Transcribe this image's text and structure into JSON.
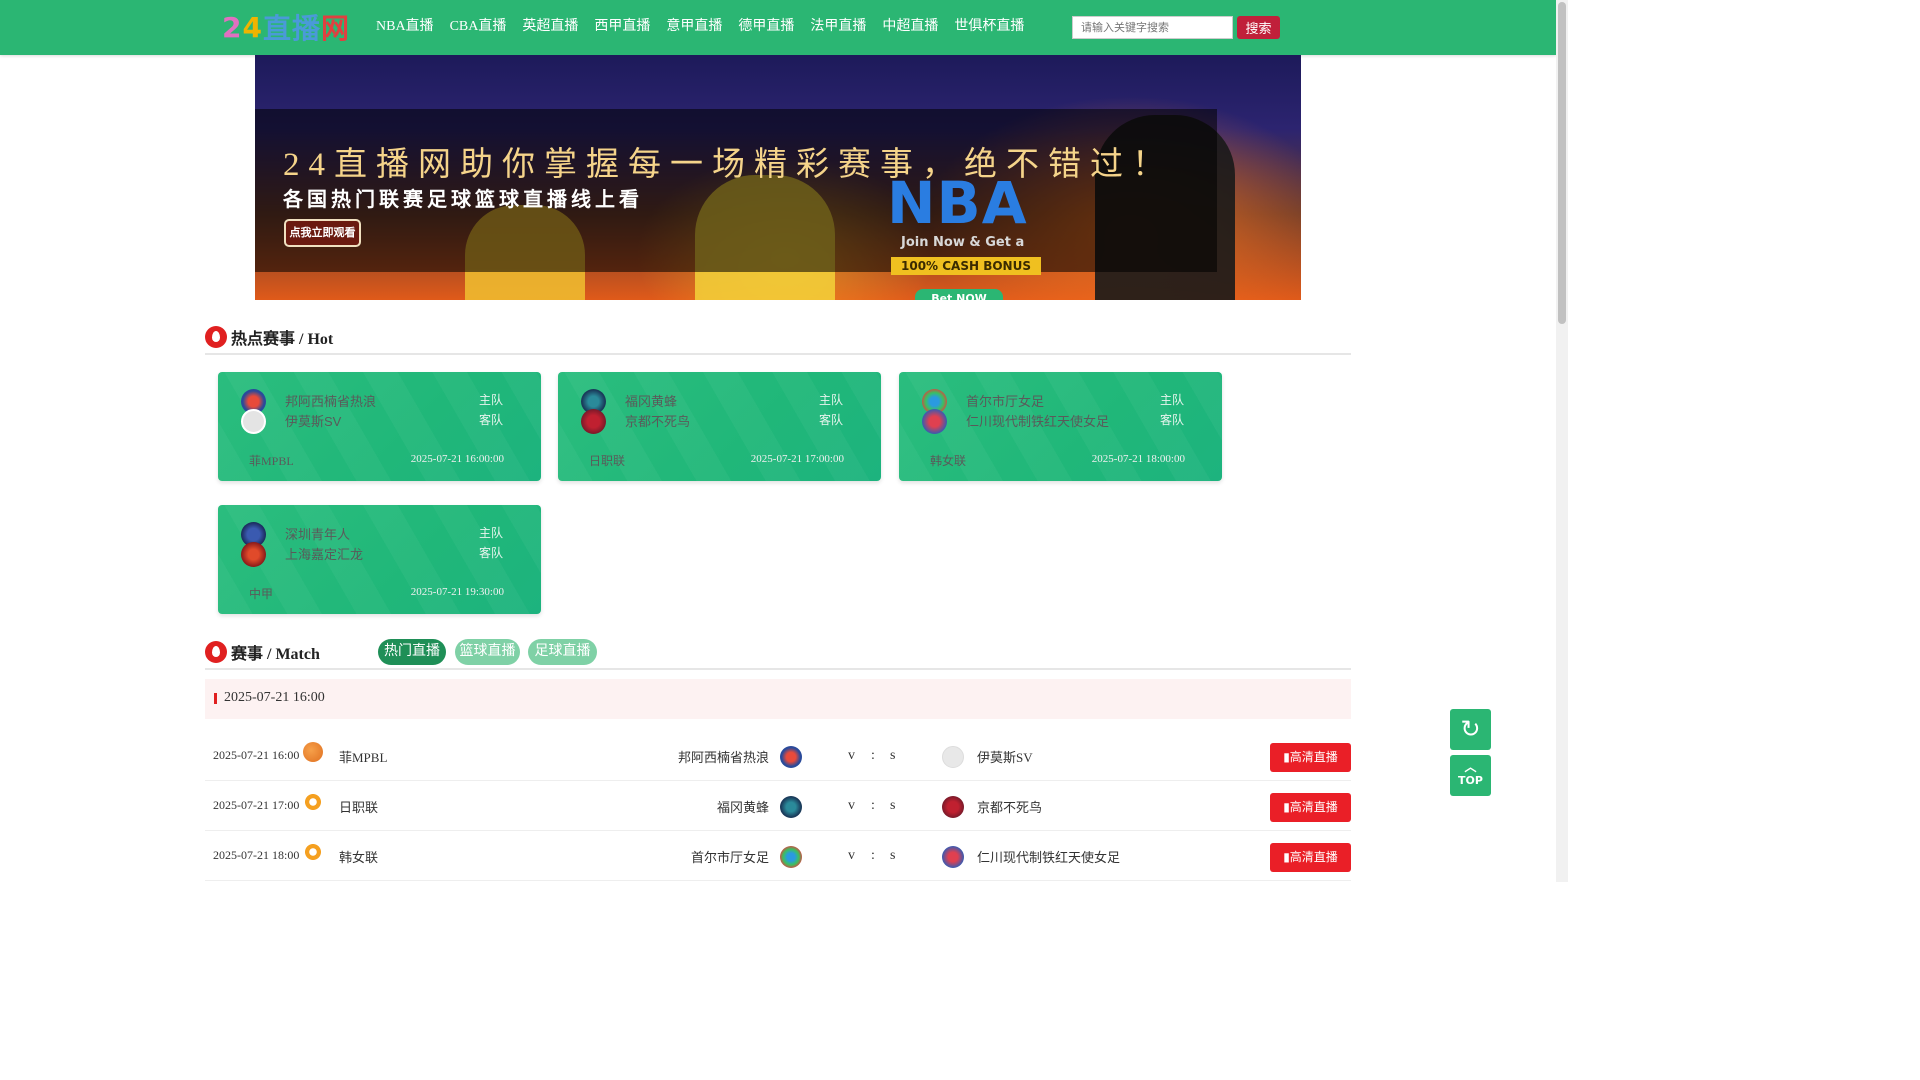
{
  "header": {
    "logo_text": "24直播网",
    "logo_parts": [
      "2",
      "4",
      "直播",
      "网"
    ],
    "nav": [
      "NBA直播",
      "CBA直播",
      "英超直播",
      "西甲直播",
      "意甲直播",
      "德甲直播",
      "法甲直播",
      "中超直播",
      "世俱杯直播"
    ],
    "search_placeholder": "请输入关键字搜索",
    "search_button": "搜索",
    "bg_color": "#2bb673"
  },
  "banner": {
    "headline": "24直播网助你掌握每一场精彩赛事，绝不错过！",
    "subline": "各国热门联赛足球篮球直播线上看",
    "button": "点我立即观看",
    "ad_brand": "NBA",
    "ad_join": "Join Now & Get a",
    "ad_bonus": "100% CASH BONUS",
    "ad_bet": "Bet NOW"
  },
  "hot": {
    "title": "热点赛事 / Hot",
    "cards": [
      {
        "home": "邦阿西楠省热浪",
        "away": "伊莫斯SV",
        "home_role": "主队",
        "away_role": "客队",
        "league": "菲MPBL",
        "time": "2025-07-21 16:00:00"
      },
      {
        "home": "福冈黄蜂",
        "away": "京都不死鸟",
        "home_role": "主队",
        "away_role": "客队",
        "league": "日职联",
        "time": "2025-07-21 17:00:00"
      },
      {
        "home": "首尔市厅女足",
        "away": "仁川现代制铁红天使女足",
        "home_role": "主队",
        "away_role": "客队",
        "league": "韩女联",
        "time": "2025-07-21 18:00:00"
      },
      {
        "home": "深圳青年人",
        "away": "上海嘉定汇龙",
        "home_role": "主队",
        "away_role": "客队",
        "league": "中甲",
        "time": "2025-07-21 19:30:00"
      }
    ]
  },
  "match": {
    "title": "赛事 / Match",
    "tabs": [
      "热门直播",
      "篮球直播",
      "足球直播"
    ],
    "date_header": "2025-07-21 16:00",
    "rows": [
      {
        "time": "2025-07-21 16:00",
        "sport": "basketball",
        "league": "菲MPBL",
        "home": "邦阿西楠省热浪",
        "v": "v",
        "colon": ":",
        "s": "s",
        "away": "伊莫斯SV",
        "live": "高清直播"
      },
      {
        "time": "2025-07-21 17:00",
        "sport": "football",
        "league": "日职联",
        "home": "福冈黄蜂",
        "v": "v",
        "colon": ":",
        "s": "s",
        "away": "京都不死鸟",
        "live": "高清直播"
      },
      {
        "time": "2025-07-21 18:00",
        "sport": "football",
        "league": "韩女联",
        "home": "首尔市厅女足",
        "v": "v",
        "colon": ":",
        "s": "s",
        "away": "仁川现代制铁红天使女足",
        "live": "高清直播"
      }
    ]
  },
  "float": {
    "refresh_icon": "↻",
    "top_label": "TOP",
    "top_icon": "︿"
  },
  "colors": {
    "primary_green": "#2bb673",
    "live_red": "#ea1f27",
    "search_btn": "#c0203a"
  }
}
